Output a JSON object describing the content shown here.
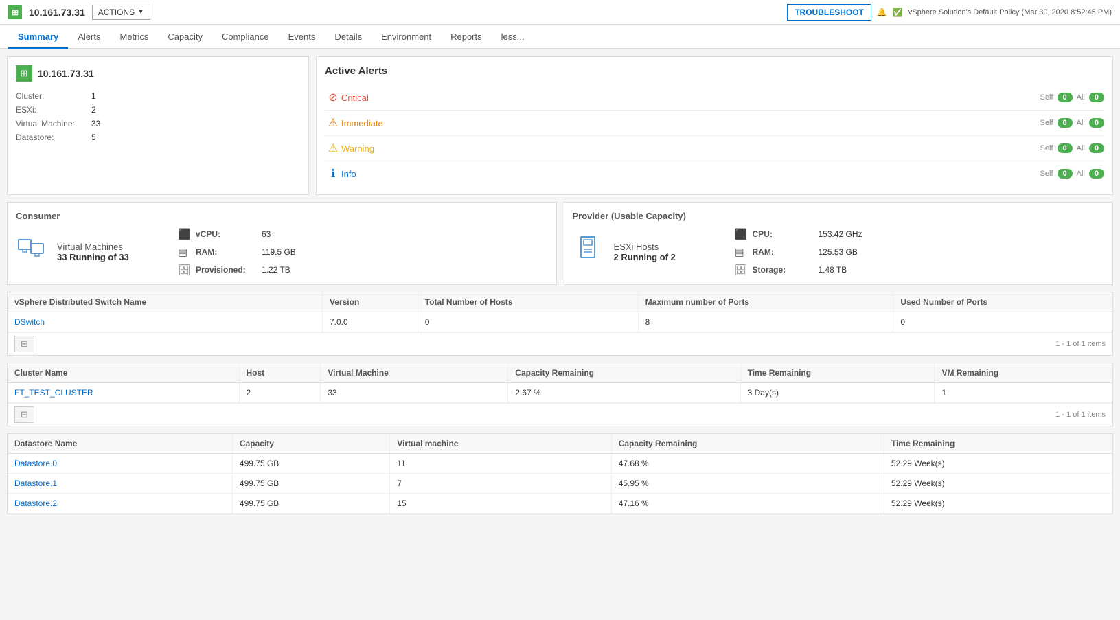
{
  "topbar": {
    "host_ip": "10.161.73.31",
    "actions_label": "ACTIONS",
    "troubleshoot_label": "TROUBLESHOOT",
    "policy_label": "vSphere Solution's Default Policy (Mar 30, 2020 8:52:45 PM)",
    "status_icons": [
      "🔔",
      "✅"
    ]
  },
  "nav": {
    "tabs": [
      {
        "id": "summary",
        "label": "Summary",
        "active": true
      },
      {
        "id": "alerts",
        "label": "Alerts",
        "active": false
      },
      {
        "id": "metrics",
        "label": "Metrics",
        "active": false
      },
      {
        "id": "capacity",
        "label": "Capacity",
        "active": false
      },
      {
        "id": "compliance",
        "label": "Compliance",
        "active": false
      },
      {
        "id": "events",
        "label": "Events",
        "active": false
      },
      {
        "id": "details",
        "label": "Details",
        "active": false
      },
      {
        "id": "environment",
        "label": "Environment",
        "active": false
      },
      {
        "id": "reports",
        "label": "Reports",
        "active": false
      },
      {
        "id": "less",
        "label": "less...",
        "active": false
      }
    ]
  },
  "info_panel": {
    "host_name": "10.161.73.31",
    "fields": [
      {
        "label": "Cluster:",
        "value": "1"
      },
      {
        "label": "ESXi:",
        "value": "2"
      },
      {
        "label": "Virtual Machine:",
        "value": "33"
      },
      {
        "label": "Datastore:",
        "value": "5"
      }
    ]
  },
  "alerts_panel": {
    "title": "Active Alerts",
    "alerts": [
      {
        "type": "critical",
        "name": "Critical",
        "icon": "⊘",
        "self": "0",
        "all": "0"
      },
      {
        "type": "immediate",
        "name": "Immediate",
        "icon": "⚠",
        "self": "0",
        "all": "0"
      },
      {
        "type": "warning",
        "name": "Warning",
        "icon": "△",
        "self": "0",
        "all": "0"
      },
      {
        "type": "info",
        "name": "Info",
        "icon": "ℹ",
        "self": "0",
        "all": "0"
      }
    ],
    "self_label": "Self",
    "all_label": "All"
  },
  "consumer": {
    "title": "Consumer",
    "type": "Virtual Machines",
    "count": "33 Running of 33",
    "metrics": [
      {
        "label": "vCPU:",
        "value": "63"
      },
      {
        "label": "RAM:",
        "value": "119.5 GB"
      },
      {
        "label": "Provisioned:",
        "value": "1.22 TB"
      }
    ]
  },
  "provider": {
    "title": "Provider (Usable Capacity)",
    "type": "ESXi Hosts",
    "count": "2 Running of 2",
    "metrics": [
      {
        "label": "CPU:",
        "value": "153.42 GHz"
      },
      {
        "label": "RAM:",
        "value": "125.53 GB"
      },
      {
        "label": "Storage:",
        "value": "1.48 TB"
      }
    ]
  },
  "switch_table": {
    "columns": [
      {
        "label": "vSphere Distributed Switch Name"
      },
      {
        "label": "Version"
      },
      {
        "label": "Total Number of Hosts"
      },
      {
        "label": "Maximum number of Ports"
      },
      {
        "label": "Used Number of Ports"
      }
    ],
    "rows": [
      {
        "name": "DSwitch",
        "version": "7.0.0",
        "total_hosts": "0",
        "max_ports": "8",
        "used_ports": "0"
      }
    ],
    "footer": "1 - 1 of 1 items"
  },
  "cluster_table": {
    "columns": [
      {
        "label": "Cluster Name"
      },
      {
        "label": "Host"
      },
      {
        "label": "Virtual Machine"
      },
      {
        "label": "Capacity Remaining"
      },
      {
        "label": "Time Remaining"
      },
      {
        "label": "VM Remaining"
      }
    ],
    "rows": [
      {
        "name": "FT_TEST_CLUSTER",
        "host": "2",
        "vm": "33",
        "capacity": "2.67 %",
        "time": "3 Day(s)",
        "vm_rem": "1"
      }
    ],
    "footer": "1 - 1 of 1 items"
  },
  "datastore_table": {
    "columns": [
      {
        "label": "Datastore Name"
      },
      {
        "label": "Capacity"
      },
      {
        "label": "Virtual machine"
      },
      {
        "label": "Capacity Remaining"
      },
      {
        "label": "Time Remaining"
      }
    ],
    "rows": [
      {
        "name": "Datastore.0",
        "capacity": "499.75 GB",
        "vm": "11",
        "cap_rem": "47.68 %",
        "time_rem": "52.29 Week(s)"
      },
      {
        "name": "Datastore.1",
        "capacity": "499.75 GB",
        "vm": "7",
        "cap_rem": "45.95 %",
        "time_rem": "52.29 Week(s)"
      },
      {
        "name": "Datastore.2",
        "capacity": "499.75 GB",
        "vm": "15",
        "cap_rem": "47.16 %",
        "time_rem": "52.29 Week(s)"
      }
    ]
  }
}
